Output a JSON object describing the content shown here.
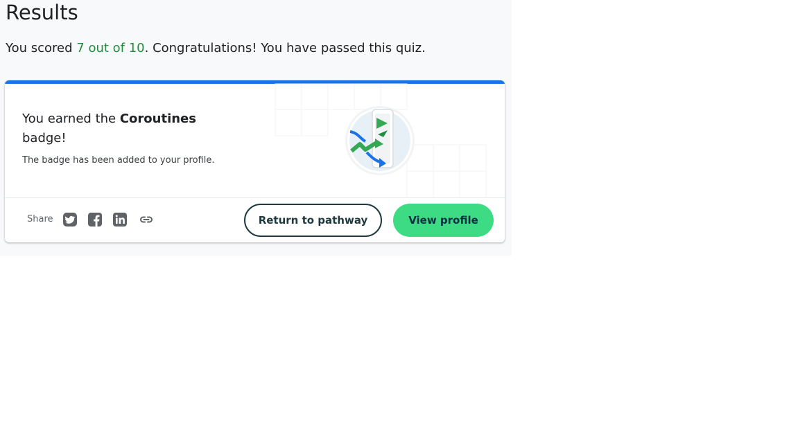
{
  "results": {
    "title": "Results",
    "score_prefix": "You scored ",
    "score_value": "7 out of 10",
    "score_suffix": ". Congratulations! You have passed this quiz."
  },
  "badge_card": {
    "earned_prefix": "You earned the ",
    "badge_name": "Coroutines",
    "earned_suffix": " badge!",
    "added_text": "The badge has been added to your profile.",
    "badge_image_icon": "coroutines-badge-icon"
  },
  "share": {
    "label": "Share",
    "icons": [
      "twitter-icon",
      "facebook-icon",
      "linkedin-icon",
      "link-icon"
    ]
  },
  "buttons": {
    "return_label": "Return to pathway",
    "view_profile_label": "View profile"
  },
  "colors": {
    "accent_blue": "#1a73e8",
    "score_green": "#1e8e3e",
    "button_green": "#3ddc84",
    "button_dark": "#1e3a3e"
  }
}
